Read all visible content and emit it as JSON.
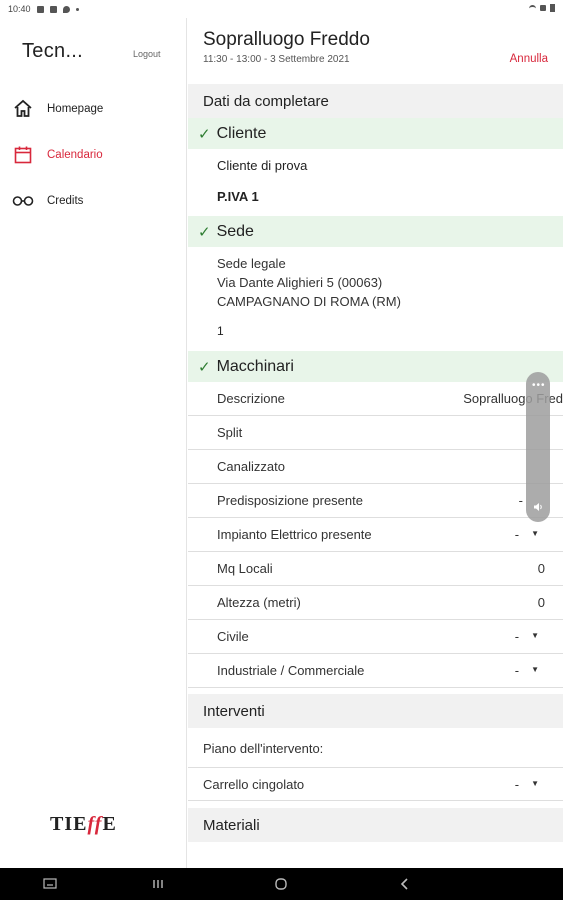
{
  "status_bar": {
    "time": "10:40"
  },
  "sidebar": {
    "app_title": "Tecn...",
    "logout_label": "Logout",
    "items": [
      {
        "label": "Homepage",
        "icon": "home-icon",
        "active": false
      },
      {
        "label": "Calendario",
        "icon": "calendar-icon",
        "active": true
      },
      {
        "label": "Credits",
        "icon": "glasses-icon",
        "active": false
      }
    ],
    "logo": {
      "prefix": "TIE",
      "ff": "ff",
      "suffix": "E"
    }
  },
  "header": {
    "title": "Sopralluogo Freddo",
    "subtitle": "11:30 - 13:00 - 3 Settembre 2021",
    "cancel_label": "Annulla"
  },
  "sections": {
    "dati": "Dati da completare",
    "interventi": "Interventi",
    "materiali": "Materiali"
  },
  "cliente": {
    "heading": "Cliente",
    "name": "Cliente di prova",
    "piva": "P.IVA 1"
  },
  "sede": {
    "heading": "Sede",
    "line1": "Sede legale",
    "line2": "Via Dante Alighieri 5 (00063)",
    "line3": "CAMPAGNANO DI ROMA (RM)",
    "number": "1"
  },
  "macchinari": {
    "heading": "Macchinari",
    "rows": [
      {
        "label": "Descrizione",
        "value": "Sopralluogo Fred",
        "kind": "text"
      },
      {
        "label": "Split",
        "value": "",
        "kind": "text"
      },
      {
        "label": "Canalizzato",
        "value": "",
        "kind": "text"
      },
      {
        "label": "Predisposizione presente",
        "value": "-",
        "kind": "select"
      },
      {
        "label": "Impianto Elettrico presente",
        "value": "-",
        "kind": "select"
      },
      {
        "label": "Mq Locali",
        "value": "0",
        "kind": "text"
      },
      {
        "label": "Altezza (metri)",
        "value": "0",
        "kind": "text"
      },
      {
        "label": "Civile",
        "value": "-",
        "kind": "select"
      },
      {
        "label": "Industriale / Commerciale",
        "value": "-",
        "kind": "select"
      }
    ]
  },
  "interventi": {
    "piano_label": "Piano dell'intervento:",
    "carrello_label": "Carrello cingolato",
    "carrello_value": "-"
  },
  "colors": {
    "accent": "#d8283c",
    "check": "#2e7d32",
    "group_bg": "#e8f5e9",
    "section_bg": "#f1f1f1"
  }
}
